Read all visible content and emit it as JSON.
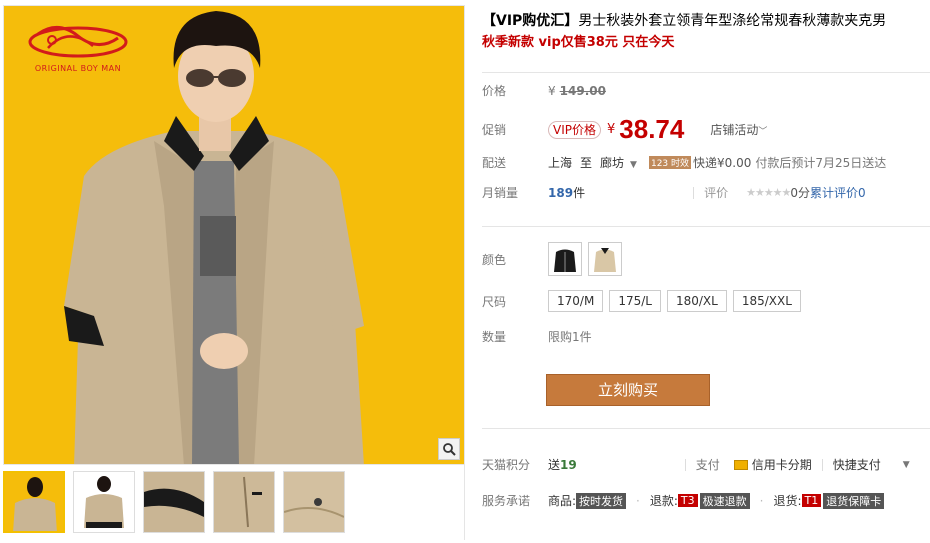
{
  "brand": {
    "logo_text": "ORIGINAL BOY MAN"
  },
  "product": {
    "title_prefix": "【VIP购优汇】",
    "title_rest": "男士秋装外套立领青年型涤纶常规春秋薄款夹克男",
    "subtitle": "秋季新款 vip仅售38元 只在今天"
  },
  "pricing": {
    "orig_label": "价格",
    "orig_currency": "¥",
    "orig_value": "149.00",
    "promo_label": "促销",
    "vip_tag": "VIP价格",
    "currency": "¥",
    "price": "38.74",
    "store_activity": "店铺活动"
  },
  "shipping": {
    "label": "配送",
    "from": "上海",
    "to_word": "至",
    "to": "廊坊",
    "badge": "123 时效",
    "express": "快递¥0.00",
    "eta": "付款后预计7月25日送达"
  },
  "sales": {
    "label": "月销量",
    "count": "189",
    "unit": "件",
    "review_label": "评价",
    "stars": "★★★★★",
    "score": "0分",
    "review_count": "累计评价0"
  },
  "options": {
    "color_label": "颜色",
    "colors": [
      "black",
      "khaki"
    ],
    "size_label": "尺码",
    "sizes": [
      "170/M",
      "175/L",
      "180/XL",
      "185/XXL"
    ],
    "qty_label": "数量",
    "qty_limit": "限购1件"
  },
  "actions": {
    "buy_now": "立刻购买"
  },
  "extras": {
    "points_label": "天猫积分",
    "points_prefix": "送",
    "points_value": "19",
    "pay_label": "支付",
    "credit_installment": "信用卡分期",
    "quick_pay": "快捷支付",
    "service_label": "服务承诺",
    "goods_word": "商品:",
    "on_time": "按时发货",
    "refund_word": "退款:",
    "refund_tag": "T3",
    "refund_text": "极速退款",
    "return_word": "退货:",
    "return_tag": "T1",
    "return_text": "退货保障卡"
  },
  "colors": {
    "accent_red": "#c40000",
    "buy_button": "#c67a3c",
    "main_bg": "#f5bd0b"
  }
}
